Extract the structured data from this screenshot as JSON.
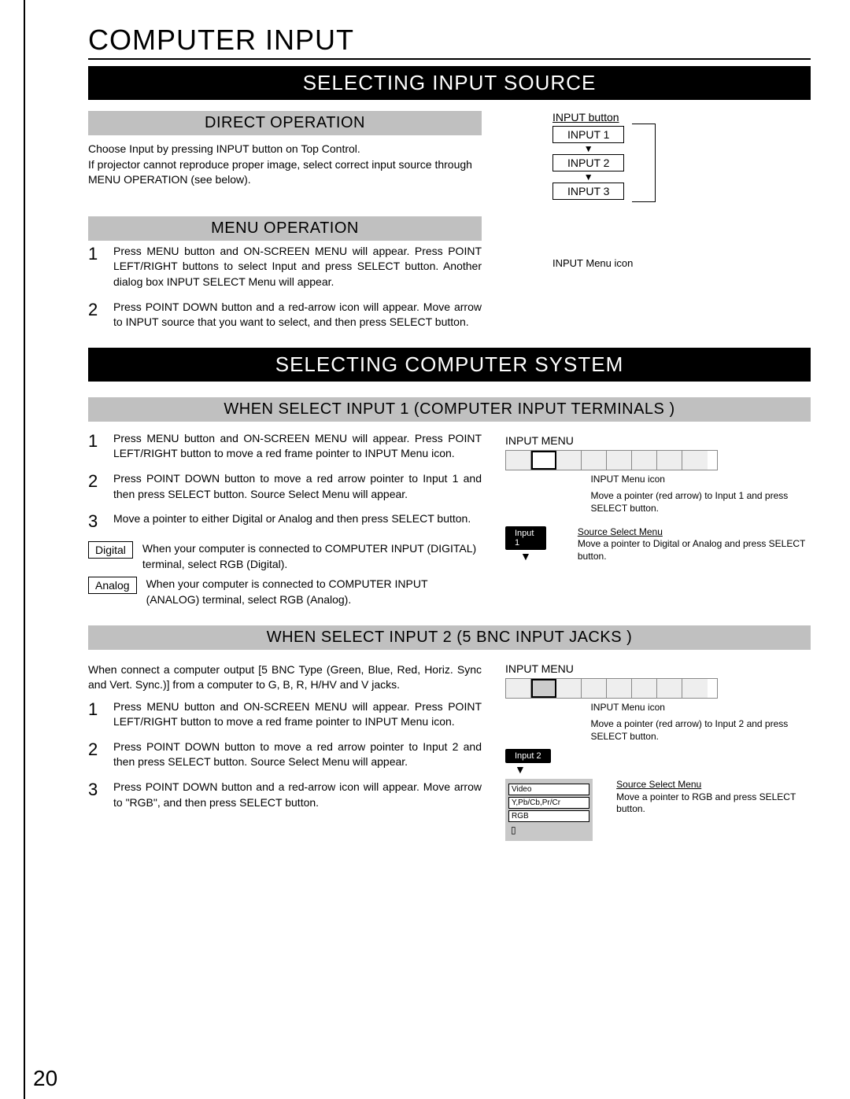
{
  "page_number": "20",
  "h1": "COMPUTER INPUT",
  "section1": {
    "title": "SELECTING INPUT SOURCE",
    "direct_op_heading": "DIRECT OPERATION",
    "direct_op_text": "Choose Input by pressing INPUT button on Top Control.\nIf projector cannot reproduce proper image, select correct input source through MENU OPERATION (see below).",
    "input_button_label": "INPUT button",
    "inputs": [
      "INPUT 1",
      "INPUT 2",
      "INPUT 3"
    ],
    "input_menu_icon_label": "INPUT Menu icon",
    "menu_op_heading": "MENU OPERATION",
    "menu_steps": [
      "Press MENU button and ON-SCREEN MENU will appear.  Press POINT LEFT/RIGHT buttons to select Input and press  SELECT button.  Another dialog box INPUT SELECT Menu will appear.",
      "Press POINT DOWN button and a red-arrow icon will appear. Move arrow to INPUT source that you want to select, and then press SELECT button."
    ]
  },
  "section2": {
    "title": "SELECTING COMPUTER SYSTEM",
    "sub1_heading": "WHEN SELECT  INPUT 1 (COMPUTER INPUT TERMINALS )",
    "sub1_steps": [
      "Press MENU button and ON-SCREEN MENU will appear.  Press POINT LEFT/RIGHT button to move a red frame pointer to INPUT Menu icon.",
      "Press POINT DOWN button to move a red arrow pointer to Input 1 and then press SELECT button.  Source Select Menu will appear.",
      "Move a pointer to either Digital or Analog and then press SELECT button."
    ],
    "options": [
      {
        "label": "Digital",
        "text": "When your computer is connected to COMPUTER INPUT (DIGITAL) terminal, select RGB (Digital)."
      },
      {
        "label": "Analog",
        "text": "When your computer is connected to COMPUTER INPUT (ANALOG) terminal, select RGB (Analog)."
      }
    ],
    "diag1": {
      "title": "INPUT MENU",
      "icon_label": "INPUT Menu icon",
      "pointer_note": "Move a pointer (red arrow) to Input 1 and press SELECT button.",
      "src_tab": "Input 1",
      "src_menu_label": "Source Select Menu",
      "src_note": "Move a pointer to Digital or Analog and press SELECT button."
    },
    "sub2_heading": "WHEN SELECT INPUT 2 (5 BNC INPUT JACKS )",
    "sub2_intro": "When connect a computer output [5 BNC Type (Green, Blue, Red, Horiz. Sync and Vert. Sync.)] from a computer to G, B, R, H/HV and V jacks.",
    "sub2_steps": [
      "Press MENU button and ON-SCREEN MENU will appear.  Press POINT LEFT/RIGHT button to move a red frame pointer to INPUT Menu icon.",
      "Press POINT DOWN button to move a red arrow pointer to Input 2 and then press SELECT button.  Source Select Menu will appear.",
      "Press POINT DOWN button and a red-arrow icon will appear. Move arrow to \"RGB\", and then press SELECT button."
    ],
    "diag2": {
      "title": "INPUT MENU",
      "icon_label": "INPUT Menu icon",
      "pointer_note": "Move a pointer (red arrow) to Input 2 and press SELECT button.",
      "src_tab": "Input 2",
      "src_menu_label": "Source Select Menu",
      "src_note": "Move a pointer to RGB and press SELECT button.",
      "submenu": [
        "Video",
        "Y,Pb/Cb,Pr/Cr",
        "RGB"
      ]
    }
  }
}
